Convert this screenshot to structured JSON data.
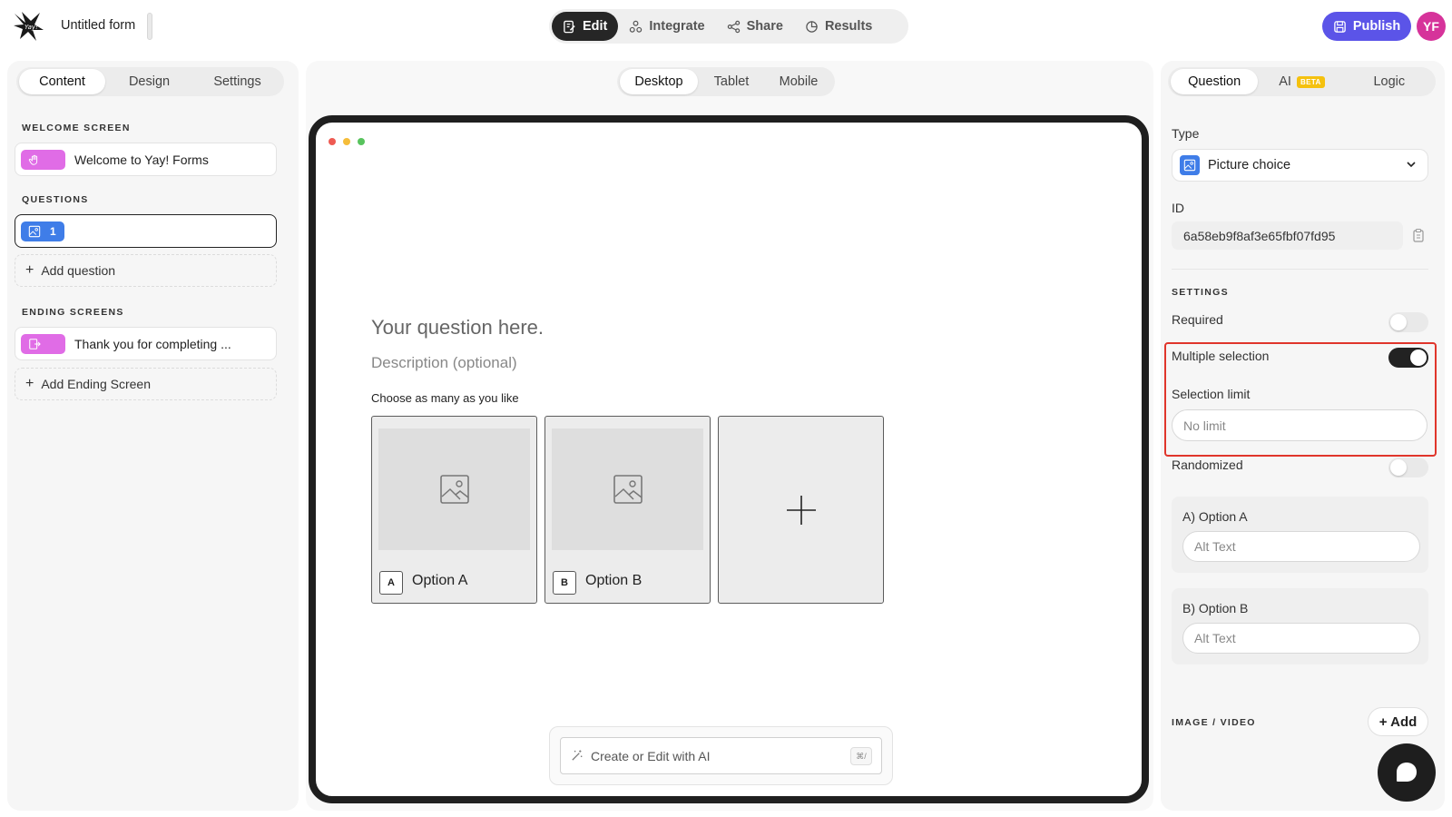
{
  "header": {
    "form_title": "Untitled form",
    "nav": [
      {
        "label": "Edit",
        "icon": "edit-icon",
        "active": true
      },
      {
        "label": "Integrate",
        "icon": "integrate-icon",
        "active": false
      },
      {
        "label": "Share",
        "icon": "share-icon",
        "active": false
      },
      {
        "label": "Results",
        "icon": "results-icon",
        "active": false
      }
    ],
    "publish_label": "Publish",
    "avatar_initials": "YF"
  },
  "left_panel": {
    "tabs": [
      "Content",
      "Design",
      "Settings"
    ],
    "welcome_label": "WELCOME SCREEN",
    "welcome_item": "Welcome to Yay! Forms",
    "questions_label": "QUESTIONS",
    "question_number": "1",
    "add_question": "Add question",
    "ending_label": "ENDING SCREENS",
    "ending_item": "Thank you for completing ...",
    "add_ending": "Add Ending Screen"
  },
  "preview": {
    "device_tabs": [
      "Desktop",
      "Tablet",
      "Mobile"
    ],
    "question_title": "Your question here.",
    "question_description": "Description (optional)",
    "hint": "Choose as many as you like",
    "choices": [
      {
        "key": "A",
        "label": "Option A"
      },
      {
        "key": "B",
        "label": "Option B"
      }
    ],
    "ai_placeholder": "Create or Edit with AI",
    "ai_shortcut": "⌘/"
  },
  "right_panel": {
    "tabs": [
      "Question",
      "AI",
      "Logic"
    ],
    "ai_badge": "BETA",
    "type_label": "Type",
    "type_value": "Picture choice",
    "id_label": "ID",
    "id_value": "6a58eb9f8af3e65fbf07fd95",
    "settings_label": "SETTINGS",
    "required_label": "Required",
    "required": false,
    "multiple_label": "Multiple selection",
    "multiple": true,
    "limit_label": "Selection limit",
    "limit_placeholder": "No limit",
    "randomized_label": "Randomized",
    "randomized": false,
    "option_a_label": "A) Option A",
    "option_b_label": "B) Option B",
    "alt_placeholder": "Alt Text",
    "media_label": "IMAGE / VIDEO",
    "add_label": "+ Add"
  },
  "colors": {
    "accent": "#5b54e8",
    "avatar": "#d6339a",
    "highlight": "#e0352b",
    "question_pill": "#3f7de8",
    "screen_pill": "#e06ce6"
  }
}
